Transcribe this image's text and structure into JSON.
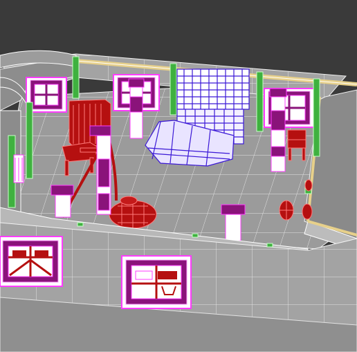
{
  "viewport": {
    "background": "#3a3a3a",
    "colors": {
      "floor": "#9b9b9b",
      "floor_grid": "#e6e6e6",
      "wall": "#a3a3a3",
      "wall_dark": "#858585",
      "wire": "#f4f4f4",
      "magenta": "#8a137a",
      "magenta_wire": "#ff3cff",
      "green": "#3fb13f",
      "purple_wire": "#3a17d6",
      "red": "#b51010",
      "beige": "#e7d08a"
    },
    "objects": [
      "back-wall-window-left",
      "back-wall-window-right",
      "wall-window-far-left",
      "counter-bar",
      "wardrobe",
      "chair-left",
      "chair-right",
      "floor-lamp",
      "round-table",
      "pedestal-1",
      "pedestal-2",
      "pedestal-3",
      "pedestal-4",
      "pedestal-5",
      "pedestal-6",
      "barrel",
      "front-wall-window-left",
      "front-wall-window-right"
    ]
  }
}
